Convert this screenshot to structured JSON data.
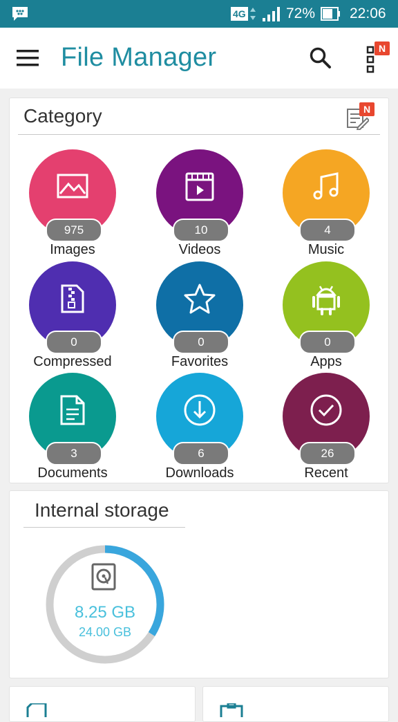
{
  "status_bar": {
    "network": "4G",
    "battery": "72%",
    "time": "22:06",
    "icons": [
      "bbm-icon",
      "signal-icon",
      "battery-icon"
    ]
  },
  "app_bar": {
    "title": "File Manager",
    "badge": "N",
    "icons": [
      "menu-icon",
      "search-icon",
      "more-icon"
    ]
  },
  "category": {
    "title": "Category",
    "badge": "N",
    "items": [
      {
        "label": "Images",
        "count": "975",
        "color": "#e4406f",
        "icon": "image-icon"
      },
      {
        "label": "Videos",
        "count": "10",
        "color": "#7a137f",
        "icon": "video-icon"
      },
      {
        "label": "Music",
        "count": "4",
        "color": "#f5a623",
        "icon": "music-icon"
      },
      {
        "label": "Compressed",
        "count": "0",
        "color": "#4f2eb0",
        "icon": "zip-icon"
      },
      {
        "label": "Favorites",
        "count": "0",
        "color": "#0f6fa6",
        "icon": "star-icon"
      },
      {
        "label": "Apps",
        "count": "0",
        "color": "#94c11f",
        "icon": "android-icon"
      },
      {
        "label": "Documents",
        "count": "3",
        "color": "#0a9a8f",
        "icon": "document-icon"
      },
      {
        "label": "Downloads",
        "count": "6",
        "color": "#16a6d8",
        "icon": "download-icon"
      },
      {
        "label": "Recent",
        "count": "26",
        "color": "#7d1f4e",
        "icon": "recent-icon"
      }
    ]
  },
  "storage": {
    "title": "Internal storage",
    "used": "8.25 GB",
    "total": "24.00 GB",
    "used_fraction": 0.34,
    "ring_color": "#39a6dd",
    "text_color": "#49c0dc"
  }
}
